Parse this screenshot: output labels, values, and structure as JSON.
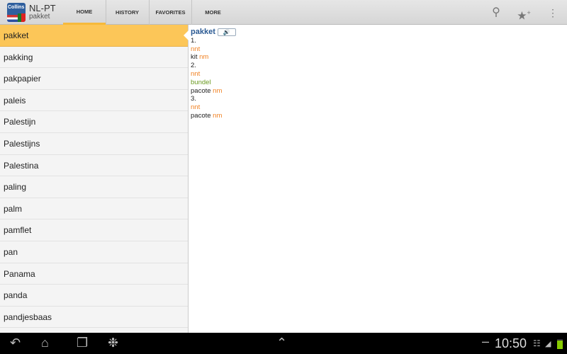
{
  "app": {
    "logo_text": "Collins",
    "title": "NL-PT",
    "subtitle": "pakket"
  },
  "tabs": [
    {
      "label": "HOME"
    },
    {
      "label": "HISTORY"
    },
    {
      "label": "FAVORITES"
    },
    {
      "label": "MORE"
    }
  ],
  "list": [
    "pakket",
    "pakking",
    "pakpapier",
    "paleis",
    "Palestijn",
    "Palestijns",
    "Palestina",
    "paling",
    "palm",
    "pamflet",
    "pan",
    "Panama",
    "panda",
    "pandjesbaas"
  ],
  "entry": {
    "headword": "pakket",
    "sound_icon": "speaker-icon",
    "senses": [
      {
        "num": "1.",
        "pos": "nnt",
        "translation": "kit",
        "gender": "nm"
      },
      {
        "num": "2.",
        "pos": "nnt",
        "gloss": "bundel",
        "translation": "pacote",
        "gender": "nm"
      },
      {
        "num": "3.",
        "pos": "nnt",
        "translation": "pacote",
        "gender": "nm"
      }
    ]
  },
  "status": {
    "time": "10:50"
  },
  "colors": {
    "accent": "#fcc658",
    "headword": "#2b5a93",
    "pos": "#f08020",
    "gloss": "#6a9a20"
  }
}
